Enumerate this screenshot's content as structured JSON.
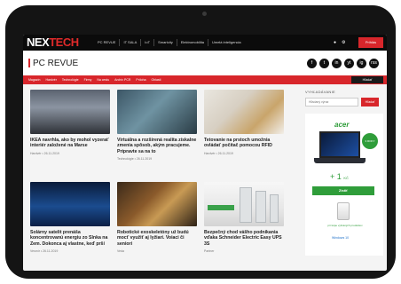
{
  "site": {
    "logo_prefix": "NEX",
    "logo_accent": "TECH"
  },
  "topnav": {
    "items": [
      "PC REVUE",
      "IT SALA",
      "IoT",
      "Smartcity",
      "Elektromobilita",
      "Umelá inteligencia"
    ],
    "signin_label": "Prihlás"
  },
  "section": {
    "title": "PC REVUE"
  },
  "socials": [
    "f",
    "t",
    "in",
    "yt",
    "ig",
    "rss"
  ],
  "category_nav": {
    "items": [
      "Magazín",
      "Hardvér",
      "Technológie",
      "Firmy",
      "Na cestu",
      "Archív PCR",
      "Príloha",
      "Oblasti"
    ],
    "search_label": "Hľadať"
  },
  "articles": [
    {
      "headline": "IKEA navrhla, ako by mohol vyzerať interiér založené na Marse",
      "meta": "Hardvér • 26.11.2019"
    },
    {
      "headline": "Virtuálna a rozšírená realita získalne zmenia spôsob, akým pracujeme. Pripravte sa na to",
      "meta": "Technológie • 26.11.2019"
    },
    {
      "headline": "Tetovanie na prstoch umožnia ovládať počítač pomocou RFID",
      "meta": "Hardvér • 26.11.2019"
    },
    {
      "headline": "Solárny satelit prenáša koncentrovanú energiu zo Slnka na Zem. Dokonca aj vlastne, keď prší",
      "meta": "Vesmír • 26.11.2019"
    },
    {
      "headline": "Robotické exoskeletóny už budú mocť využiť aj lyžiari. Voiaci či seniori",
      "meta": "Veda"
    },
    {
      "headline": "Bezpečný chod vášho podnikania vďaka Schneider Electric Easy UPS 3S",
      "meta": "Partner"
    }
  ],
  "sidebar": {
    "search_label": "VYHĽADÁVANIE",
    "search_placeholder": "Hľadaný výraz",
    "search_button": "Hľadať",
    "ad": {
      "brand": "acer",
      "badge": "3 ROKY",
      "price_prefix": "+",
      "price": "1",
      "price_unit": "KČ",
      "button": "Zistiť",
      "text": "pri kúpe vybraných produktov",
      "os": "Windows 10"
    }
  }
}
